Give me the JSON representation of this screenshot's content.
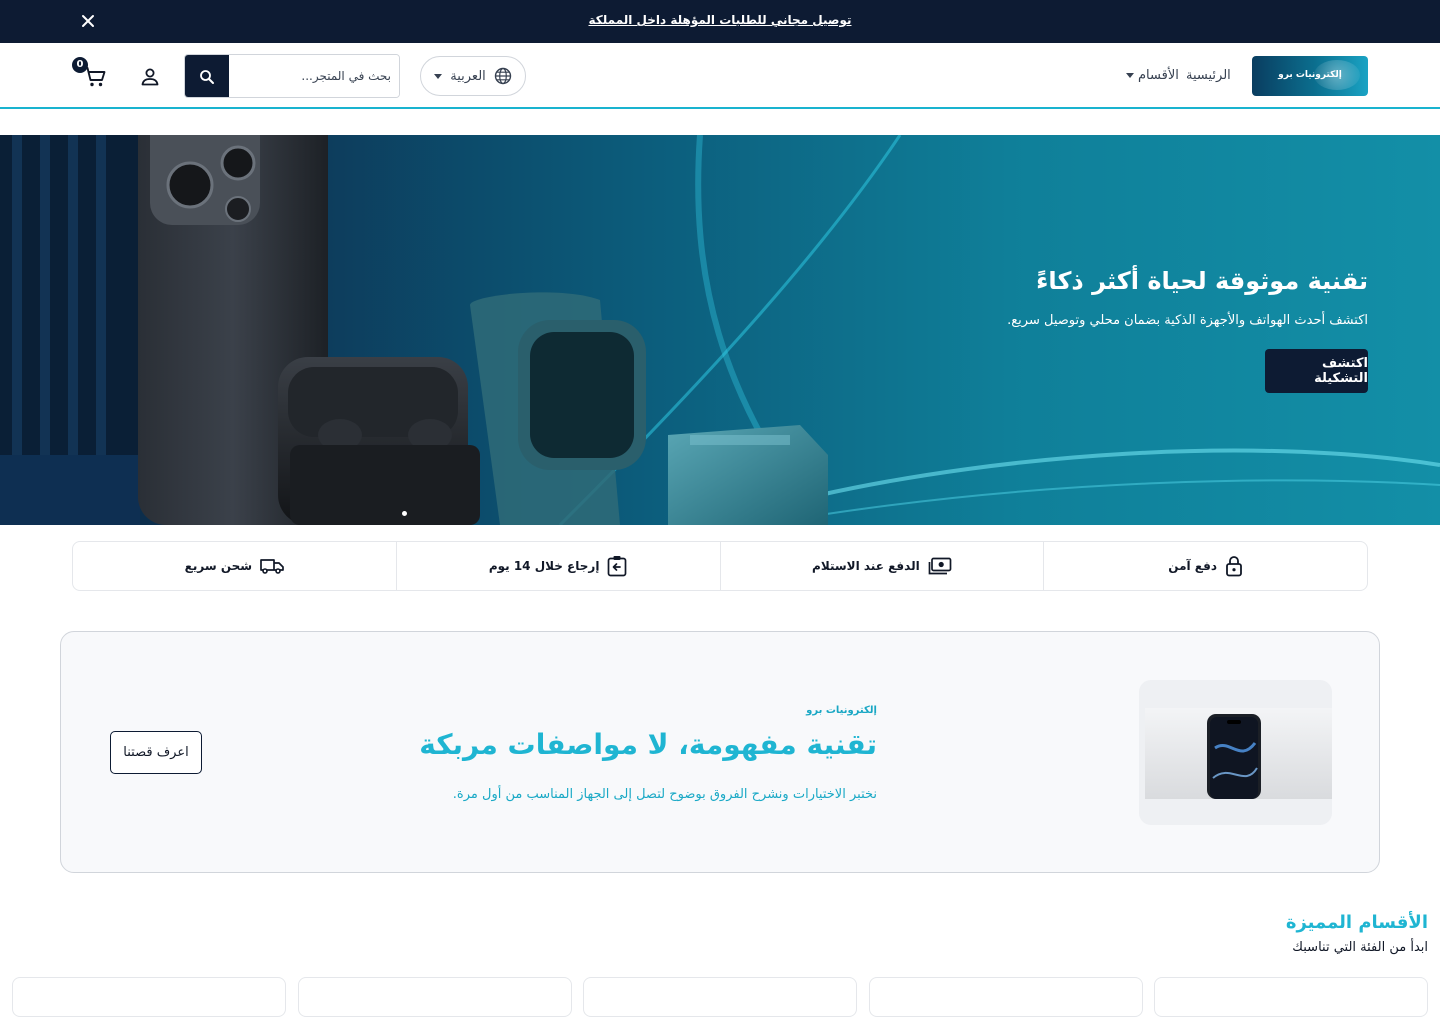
{
  "announcement": {
    "text": "توصيل مجاني للطلبات المؤهلة داخل المملكة"
  },
  "header": {
    "logo_text": "إلكترونيات برو",
    "nav": {
      "home": "الرئيسية",
      "categories": "الأقسام"
    },
    "language": "العربية",
    "search_placeholder": "بحث في المتجر...",
    "cart_count": "0"
  },
  "hero": {
    "title": "تقنية موثوقة لحياة أكثر ذكاءً",
    "subtitle": "اكتشف أحدث الهواتف والأجهزة الذكية بضمان محلي وتوصيل سريع.",
    "cta": "اكتشف التشكيلة"
  },
  "features": [
    {
      "label": "شحن سريع",
      "icon": "truck-icon"
    },
    {
      "label": "إرجاع خلال 14 يوم",
      "icon": "return-box-icon"
    },
    {
      "label": "الدفع عند الاستلام",
      "icon": "cash-icon"
    },
    {
      "label": "دفع آمن",
      "icon": "lock-icon"
    }
  ],
  "story": {
    "brand": "إلكترونيات برو",
    "title": "تقنية مفهومة، لا مواصفات مربكة",
    "description": "نختبر الاختيارات ونشرح الفروق بوضوح لتصل إلى الجهاز المناسب من أول مرة.",
    "button": "اعرف قصتنا"
  },
  "featured_categories": {
    "title": "الأقسام المميزة",
    "subtitle": "ابدأ من الفئة التي تناسبك"
  },
  "colors": {
    "navy": "#0d1b33",
    "accent": "#1fb5d2"
  }
}
